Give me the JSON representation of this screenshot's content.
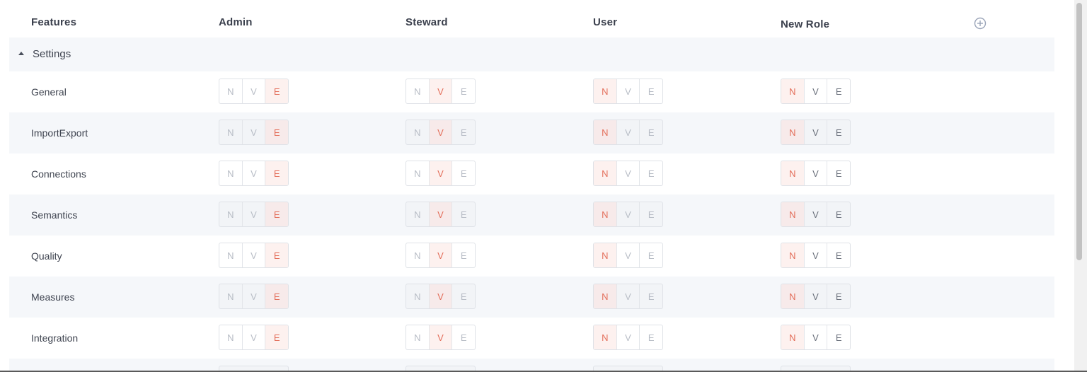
{
  "header": {
    "features": "Features",
    "roles": [
      "Admin",
      "Steward",
      "User",
      "New Role"
    ]
  },
  "group": {
    "label": "Settings",
    "expanded": true
  },
  "permission_options": [
    "N",
    "V",
    "E"
  ],
  "rows": [
    {
      "feature": "General",
      "selected": [
        "E",
        "V",
        "N",
        "N"
      ]
    },
    {
      "feature": "ImportExport",
      "selected": [
        "E",
        "V",
        "N",
        "N"
      ]
    },
    {
      "feature": "Connections",
      "selected": [
        "E",
        "V",
        "N",
        "N"
      ]
    },
    {
      "feature": "Semantics",
      "selected": [
        "E",
        "V",
        "N",
        "N"
      ]
    },
    {
      "feature": "Quality",
      "selected": [
        "E",
        "V",
        "N",
        "N"
      ]
    },
    {
      "feature": "Measures",
      "selected": [
        "E",
        "V",
        "N",
        "N"
      ]
    },
    {
      "feature": "Integration",
      "selected": [
        "E",
        "V",
        "N",
        "N"
      ]
    }
  ],
  "colors": {
    "accent": "#e36f5b",
    "selected_bg": "#fdf1ef",
    "row_alt": "#f5f7fa"
  },
  "icons": {
    "add_role": "plus-circle-icon",
    "collapse": "caret-up-icon"
  }
}
